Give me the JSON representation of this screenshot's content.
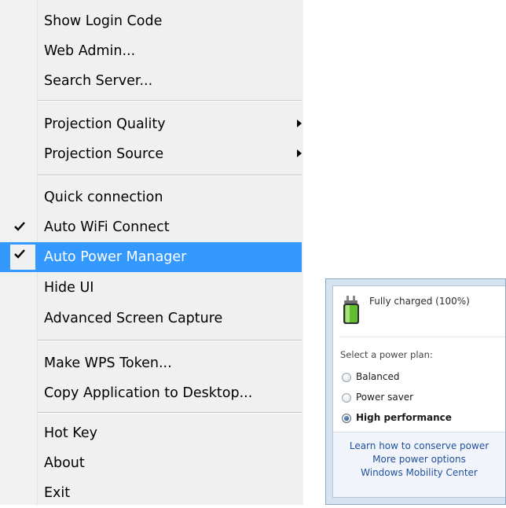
{
  "context_menu": {
    "group1": [
      {
        "label": "Show Login Code"
      },
      {
        "label": "Web Admin..."
      },
      {
        "label": "Search Server..."
      }
    ],
    "group2": [
      {
        "label": "Projection Quality",
        "submenu": true
      },
      {
        "label": "Projection Source",
        "submenu": true
      }
    ],
    "group3": [
      {
        "label": "Quick connection"
      },
      {
        "label": "Auto WiFi Connect",
        "checked": true
      },
      {
        "label": "Auto Power Manager",
        "checked": true,
        "highlighted": true
      },
      {
        "label": "Hide UI"
      },
      {
        "label": "Advanced Screen Capture"
      }
    ],
    "group4": [
      {
        "label": "Make WPS Token..."
      },
      {
        "label": "Copy Application to Desktop..."
      }
    ],
    "group5": [
      {
        "label": "Hot Key"
      },
      {
        "label": "About"
      },
      {
        "label": "Exit"
      }
    ],
    "icons": {
      "check": "checkmark-icon",
      "submenu": "submenu-arrow-icon"
    },
    "highlight_color": "#3399ff"
  },
  "power_flyout": {
    "status": "Fully charged (100%)",
    "plan_prompt": "Select a power plan:",
    "plans": [
      {
        "label": "Balanced",
        "selected": false
      },
      {
        "label": "Power saver",
        "selected": false
      },
      {
        "label": "High performance",
        "selected": true
      }
    ],
    "links": [
      {
        "label": "Learn how to conserve power"
      },
      {
        "label": "More power options"
      },
      {
        "label": "Windows Mobility Center"
      }
    ],
    "icons": {
      "battery": "battery-plugged-icon"
    },
    "link_color": "#1f4f9c"
  }
}
